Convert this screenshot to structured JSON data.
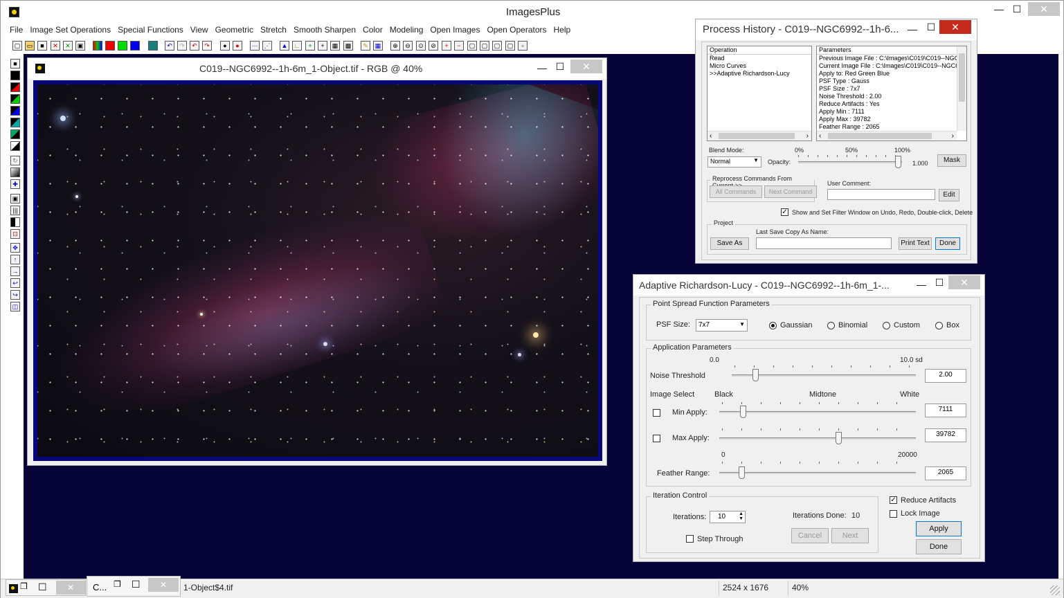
{
  "app": {
    "title": "ImagesPlus"
  },
  "menu": [
    "File",
    "Image Set Operations",
    "Special Functions",
    "View",
    "Geometric",
    "Stretch",
    "Smooth Sharpen",
    "Color",
    "Modeling",
    "Open Images",
    "Open Operators",
    "Help"
  ],
  "image_window": {
    "title": "C019--NGC6992--1h-6m_1-Object.tif - RGB @ 40%"
  },
  "history": {
    "title": "Process History - C019--NGC6992--1h-6...",
    "operation_header": "Operation",
    "operations": [
      "Read",
      "Micro Curves",
      ">>Adaptive Richardson-Lucy"
    ],
    "parameters_header": "Parameters",
    "parameters": [
      "Previous Image File : C:\\Images\\C019\\C019--NGC6",
      "Current Image File : C:\\Images\\C019\\C019--NGC69",
      "Apply to:  Red Green Blue",
      "PSF Type : Gauss",
      "PSF Size : 7x7",
      "Noise Threshold :  2.00",
      "Reduce Artifacts : Yes",
      "Apply Min : 7111",
      "Apply Max : 39782",
      "Feather Range : 2065"
    ],
    "blend_mode_label": "Blend Mode:",
    "blend_mode": "Normal",
    "opacity_label": "Opacity:",
    "opacity_ticks": [
      "0%",
      "50%",
      "100%"
    ],
    "opacity_value": "1.000",
    "mask_label": "Mask",
    "reprocess_label": "Reprocess Commands From Current >>",
    "all_commands": "All Commands",
    "next_command": "Next Command",
    "user_comment_label": "User Comment:",
    "edit_label": "Edit",
    "show_filter_label": "Show and Set Filter Window on Undo, Redo, Double-click, Delete",
    "project_label": "Project",
    "last_save_label": "Last Save Copy As Name:",
    "save_as": "Save As",
    "print_text": "Print Text",
    "done": "Done"
  },
  "arl": {
    "title": "Adaptive Richardson-Lucy - C019--NGC6992--1h-6m_1-...",
    "psf_group": "Point Spread Function Parameters",
    "psf_size_label": "PSF Size:",
    "psf_size": "7x7",
    "psf_types": [
      "Gaussian",
      "Binomial",
      "Custom",
      "Box"
    ],
    "app_group": "Application Parameters",
    "noise_min": "0.0",
    "noise_max": "10.0 sd",
    "noise_label": "Noise Threshold",
    "noise_value": "2.00",
    "image_select_label": "Image Select",
    "black": "Black",
    "midtone": "Midtone",
    "white": "White",
    "min_apply_label": "Min Apply:",
    "min_apply_value": "7111",
    "max_apply_label": "Max Apply:",
    "max_apply_value": "39782",
    "feather_min": "0",
    "feather_max": "20000",
    "feather_label": "Feather Range:",
    "feather_value": "2065",
    "iteration_group": "Iteration Control",
    "iterations_label": "Iterations:",
    "iterations_value": "10",
    "iterations_done_label": "Iterations Done:",
    "iterations_done_value": "10",
    "step_through_label": "Step Through",
    "cancel": "Cancel",
    "next": "Next",
    "reduce_artifacts_label": "Reduce Artifacts",
    "lock_image_label": "Lock Image",
    "apply": "Apply",
    "done": "Done"
  },
  "status": {
    "minimized_title": "C...",
    "file": "1-Object$4.tif",
    "dimensions": "2524 x 1676",
    "zoom": "40%"
  }
}
